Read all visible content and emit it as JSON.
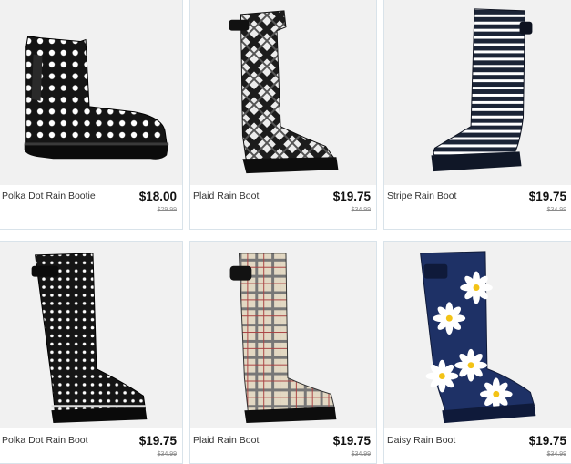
{
  "products": [
    {
      "name": "Polka Dot Rain Bootie",
      "price": "$18.00",
      "old_price": "$29.99",
      "icon": "polka-dot-bootie-image",
      "boot_color": "#151515",
      "pattern_color": "#ffffff"
    },
    {
      "name": "Plaid Rain Boot",
      "price": "$19.75",
      "old_price": "$34.99",
      "icon": "plaid-boot-image",
      "boot_color": "#e9e9e9",
      "pattern_color": "#222222"
    },
    {
      "name": "Stripe Rain Boot",
      "price": "$19.75",
      "old_price": "$34.99",
      "icon": "stripe-boot-image",
      "boot_color": "#1b2436",
      "pattern_color": "#ffffff"
    },
    {
      "name": "Polka Dot Rain Boot",
      "price": "$19.75",
      "old_price": "$34.99",
      "icon": "polka-dot-boot-image",
      "boot_color": "#151515",
      "pattern_color": "#ffffff"
    },
    {
      "name": "Plaid Rain Boot",
      "price": "$19.75",
      "old_price": "$34.99",
      "icon": "beige-plaid-boot-image",
      "boot_color": "#e2d8c3",
      "pattern_color": "#555555"
    },
    {
      "name": "Daisy Rain Boot",
      "price": "$19.75",
      "old_price": "$34.99",
      "icon": "daisy-boot-image",
      "boot_color": "#1e3166",
      "pattern_color": "#ffffff"
    }
  ]
}
